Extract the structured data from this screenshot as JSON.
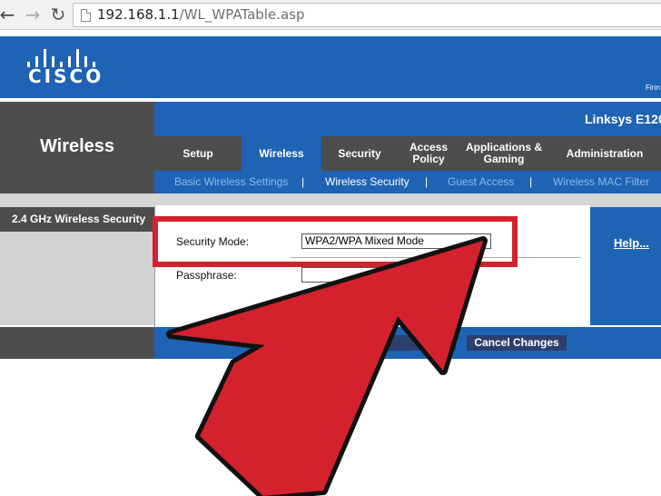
{
  "browser": {
    "url_host": "192.168.1.1",
    "url_path": "/WL_WPATable.asp",
    "back_icon": "back-arrow-icon",
    "forward_icon": "forward-arrow-icon",
    "reload_icon": "reload-icon"
  },
  "header": {
    "brand": "CISCO",
    "firmware_label": "Firm",
    "model": "Linksys E120"
  },
  "section": {
    "title": "Wireless"
  },
  "tabs": [
    {
      "label": "Setup",
      "active": false
    },
    {
      "label": "Wireless",
      "active": true
    },
    {
      "label": "Security",
      "active": false
    },
    {
      "label": "Access Policy",
      "active": false
    },
    {
      "label": "Applications & Gaming",
      "active": false
    },
    {
      "label": "Administration",
      "active": false
    }
  ],
  "subnav": [
    {
      "label": "Basic Wireless Settings",
      "active": false
    },
    {
      "label": "Wireless Security",
      "active": true
    },
    {
      "label": "Guest Access",
      "active": false
    },
    {
      "label": "Wireless MAC Filter",
      "active": false
    }
  ],
  "subnav_separator": "|",
  "panel": {
    "left_label": "2.4 GHz Wireless Security",
    "help": "Help...",
    "security_mode_label": "Security Mode:",
    "security_mode_value": "WPA2/WPA Mixed Mode",
    "passphrase_label": "Passphrase:"
  },
  "buttons": {
    "save": "ngs",
    "cancel": "Cancel Changes"
  },
  "colors": {
    "cisco_blue": "#1f63b4",
    "dark_grey": "#4d4d4d",
    "highlight_red": "#d3222d"
  }
}
